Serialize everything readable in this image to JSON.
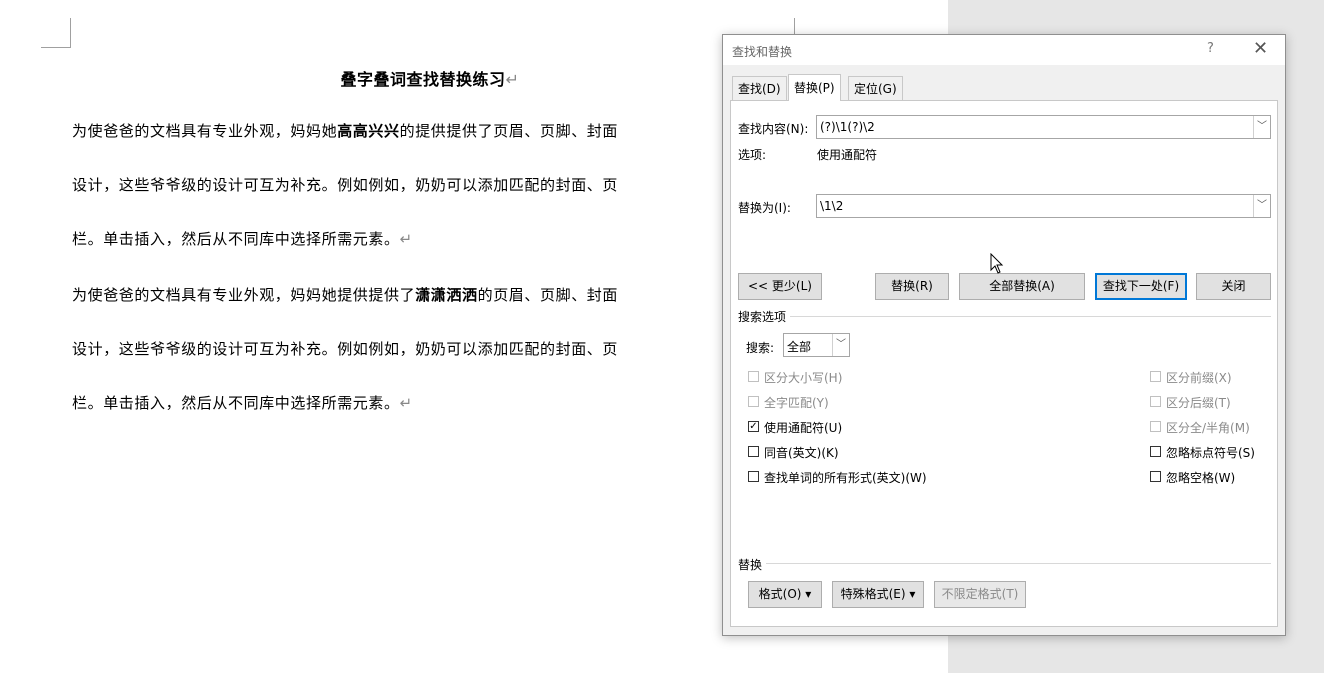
{
  "document": {
    "title": "叠字叠词查找替换练习",
    "pilcrow": "↵",
    "lines": [
      {
        "pre": "为使爸爸的文档具有专业外观，妈妈她",
        "bold": "高高兴兴",
        "post": "的提供提供了页眉、页脚、封面"
      },
      {
        "pre": "设计，这些爷爷级的设计可互为补充。例如例如，奶奶可以添加匹配的封面、页",
        "bold": "",
        "post": ""
      },
      {
        "pre": "栏。单击插入，然后从不同库中选择所需元素。",
        "bold": "",
        "post": "",
        "mark": true
      },
      {
        "pre": "为使爸爸的文档具有专业外观，妈妈她提供提供了",
        "bold": "潇潇洒洒",
        "post": "的页眉、页脚、封面"
      },
      {
        "pre": "设计，这些爷爷级的设计可互为补充。例如例如，奶奶可以添加匹配的封面、页",
        "bold": "",
        "post": ""
      },
      {
        "pre": "栏。单击插入，然后从不同库中选择所需元素。",
        "bold": "",
        "post": "",
        "mark": true
      }
    ]
  },
  "dialog": {
    "title": "查找和替换",
    "help": "?",
    "close": "✕",
    "tabs": [
      "查找(D)",
      "替换(P)",
      "定位(G)"
    ],
    "active_tab": "替换(P)",
    "find_label": "查找内容(N):",
    "find_value": "(?)\\1(?)\\2",
    "options_label": "选项:",
    "options_value": "使用通配符",
    "replace_label": "替换为(I):",
    "replace_value": "\\1\\2",
    "buttons": {
      "less": "<< 更少(L)",
      "replace": "替换(R)",
      "replace_all": "全部替换(A)",
      "find_next": "查找下一处(F)",
      "close": "关闭"
    },
    "search_options_label": "搜索选项",
    "search_label": "搜索:",
    "search_value": "全部",
    "left_options": [
      {
        "label": "区分大小写(H)",
        "checked": false,
        "disabled": true
      },
      {
        "label": "全字匹配(Y)",
        "checked": false,
        "disabled": true
      },
      {
        "label": "使用通配符(U)",
        "checked": true,
        "disabled": false
      },
      {
        "label": "同音(英文)(K)",
        "checked": false,
        "disabled": false
      },
      {
        "label": "查找单词的所有形式(英文)(W)",
        "checked": false,
        "disabled": false
      }
    ],
    "right_options": [
      {
        "label": "区分前缀(X)",
        "checked": false,
        "disabled": true
      },
      {
        "label": "区分后缀(T)",
        "checked": false,
        "disabled": true
      },
      {
        "label": "区分全/半角(M)",
        "checked": false,
        "disabled": true
      },
      {
        "label": "忽略标点符号(S)",
        "checked": false,
        "disabled": false
      },
      {
        "label": "忽略空格(W)",
        "checked": false,
        "disabled": false
      }
    ],
    "replace_section_label": "替换",
    "format_button": "格式(O) ▾",
    "special_button": "特殊格式(E) ▾",
    "no_format_button": "不限定格式(T)"
  }
}
